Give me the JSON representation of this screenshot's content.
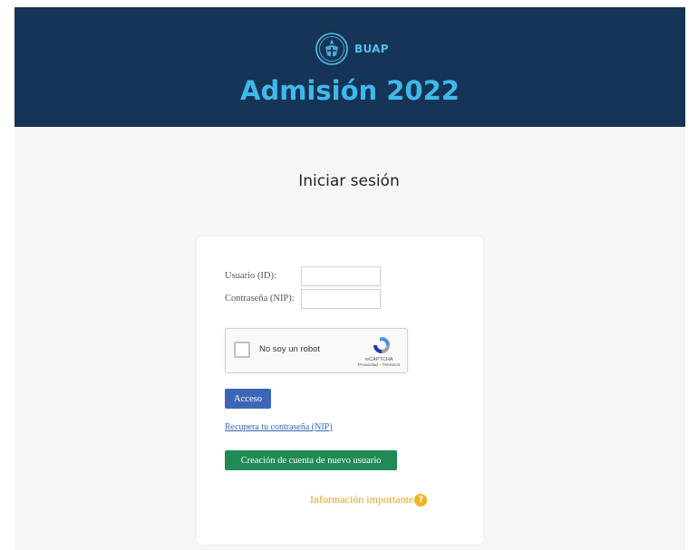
{
  "header": {
    "brand": "BUAP",
    "title": "Admisión 2022",
    "background_color": "#163455",
    "accent_color": "#3fb9ec",
    "logo_icon": "buap-emblem-icon"
  },
  "login": {
    "title": "Iniciar sesión",
    "user_label": "Usuario (ID):",
    "user_value": "",
    "password_label": "Contraseña (NIP):",
    "password_value": "",
    "recaptcha": {
      "label": "No soy un robot",
      "brand": "reCAPTCHA",
      "links": "Privacidad - Términos",
      "icon": "recaptcha-logo-icon"
    },
    "submit_label": "Acceso",
    "recover_link": "Recupera tu contraseña (NIP)",
    "create_account_label": "Creación de cuenta de nuevo usuario",
    "info_link": "Información importante",
    "info_icon_glyph": "?",
    "primary_color": "#3c66b5",
    "success_color": "#208a55",
    "warning_color": "#e3a51a"
  }
}
